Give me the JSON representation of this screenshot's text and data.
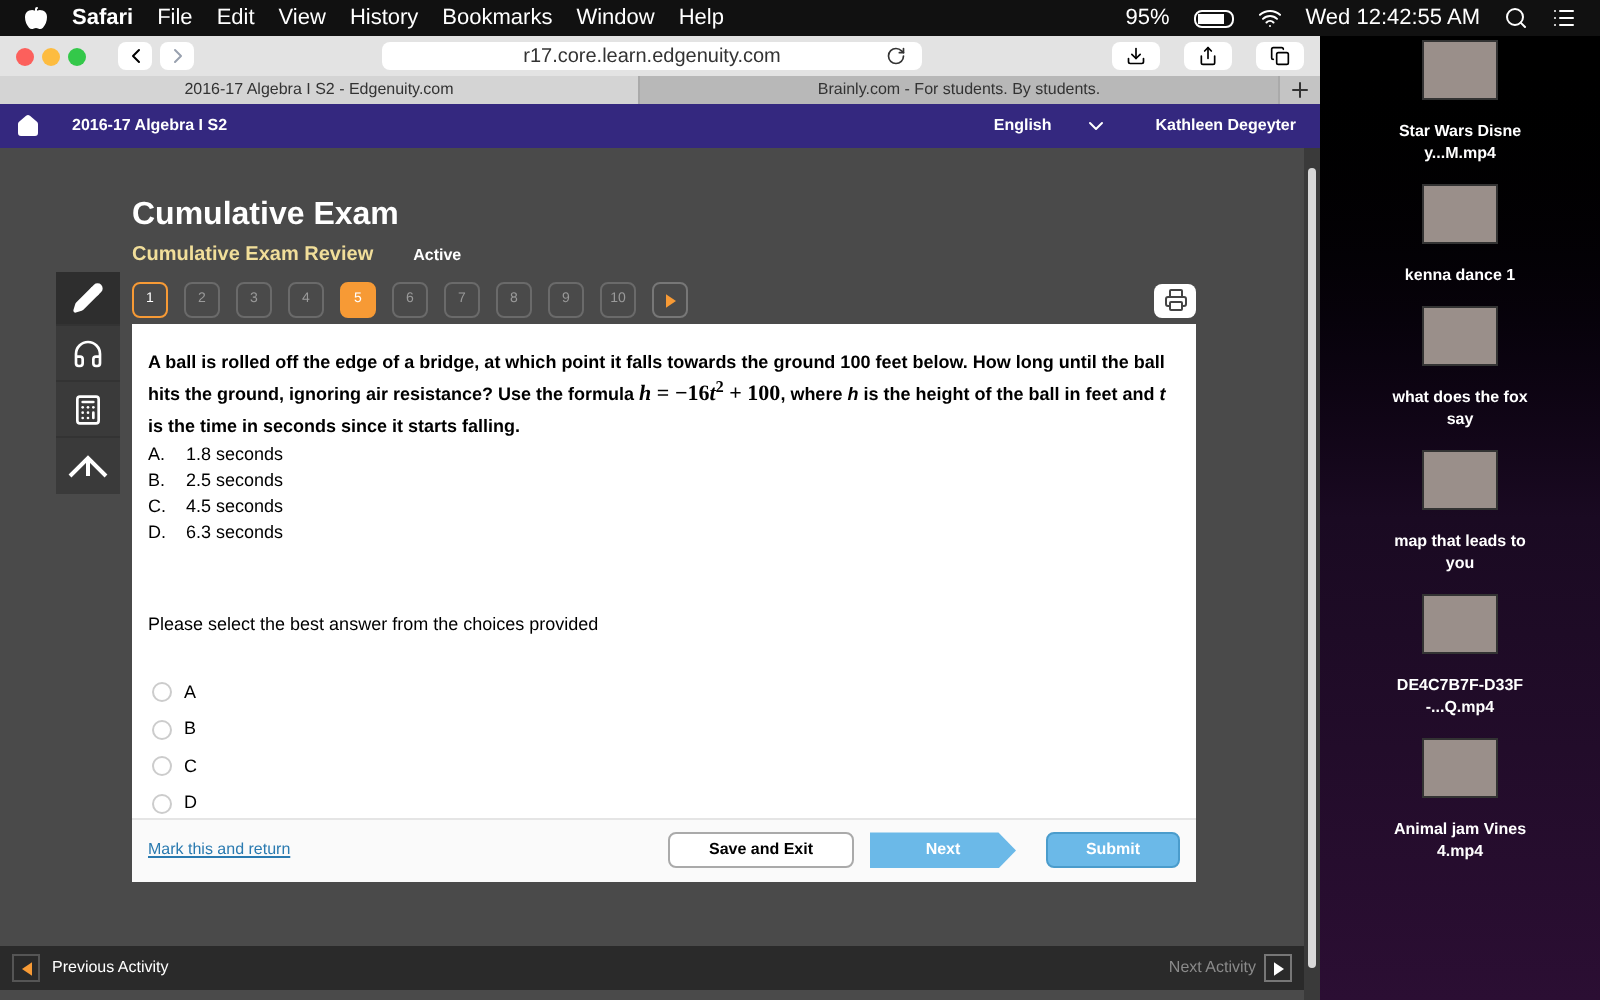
{
  "menu_bar": {
    "app": "Safari",
    "items": [
      "File",
      "Edit",
      "View",
      "History",
      "Bookmarks",
      "Window",
      "Help"
    ],
    "battery": "95%",
    "clock": "Wed 12:42:55 AM"
  },
  "browser": {
    "url": "r17.core.learn.edgenuity.com",
    "tabs": [
      {
        "label": "2016-17 Algebra I S2 - Edgenuity.com",
        "selected": true
      },
      {
        "label": "Brainly.com - For students. By students.",
        "selected": false
      }
    ]
  },
  "nav": {
    "course": "2016-17 Algebra I S2",
    "language": "English",
    "user": "Kathleen Degeyter"
  },
  "header": {
    "title": "Cumulative Exam",
    "subtitle": "Cumulative Exam Review",
    "status": "Active"
  },
  "pages": [
    {
      "label": "1",
      "selected": false,
      "visited": true
    },
    {
      "label": "2",
      "selected": false,
      "visited": false
    },
    {
      "label": "3",
      "selected": false,
      "visited": false
    },
    {
      "label": "4",
      "selected": false,
      "visited": false
    },
    {
      "label": "5",
      "selected": true,
      "visited": true
    },
    {
      "label": "6",
      "selected": false,
      "visited": false
    },
    {
      "label": "7",
      "selected": false,
      "visited": false
    },
    {
      "label": "8",
      "selected": false,
      "visited": false
    },
    {
      "label": "9",
      "selected": false,
      "visited": false
    },
    {
      "label": "10",
      "selected": false,
      "visited": false
    }
  ],
  "question": {
    "before": "A ball is rolled off the edge of a bridge, at which point it falls towards the ground 100 feet below. How long until the ball hits the ground, ignoring air resistance? Use the formula ",
    "formula": {
      "lhs": "h",
      "middle": " = −16",
      "variable": "t",
      "exponent": "2",
      "tail": " + 100"
    },
    "after": ", where *h* is the height of the ball in feet and *t* is the time in seconds since it starts falling.",
    "choices": [
      {
        "letter": "A.",
        "text": "1.8 seconds"
      },
      {
        "letter": "B.",
        "text": "2.5 seconds"
      },
      {
        "letter": "C.",
        "text": "4.5 seconds"
      },
      {
        "letter": "D.",
        "text": "6.3 seconds"
      }
    ]
  },
  "prompt": "Please select the best answer from the choices provided",
  "options": [
    {
      "label": "A",
      "selected": false
    },
    {
      "label": "B",
      "selected": false
    },
    {
      "label": "C",
      "selected": false
    },
    {
      "label": "D",
      "selected": false
    }
  ],
  "footer": {
    "mark_link": "Mark this and return",
    "save": "Save and Exit",
    "next": "Next",
    "submit": "Submit"
  },
  "activity_bar": {
    "previous": "Previous Activity",
    "next": "Next Activity"
  },
  "desktop_files": [
    {
      "label": "Star Wars Disney...M.mp4"
    },
    {
      "label": "kenna dance 1"
    },
    {
      "label": "what does the fox say"
    },
    {
      "label": "map that leads to you"
    },
    {
      "label": "DE4C7B7F-D33F-...Q.mp4"
    },
    {
      "label": "Animal jam Vines 4.mp4"
    }
  ]
}
